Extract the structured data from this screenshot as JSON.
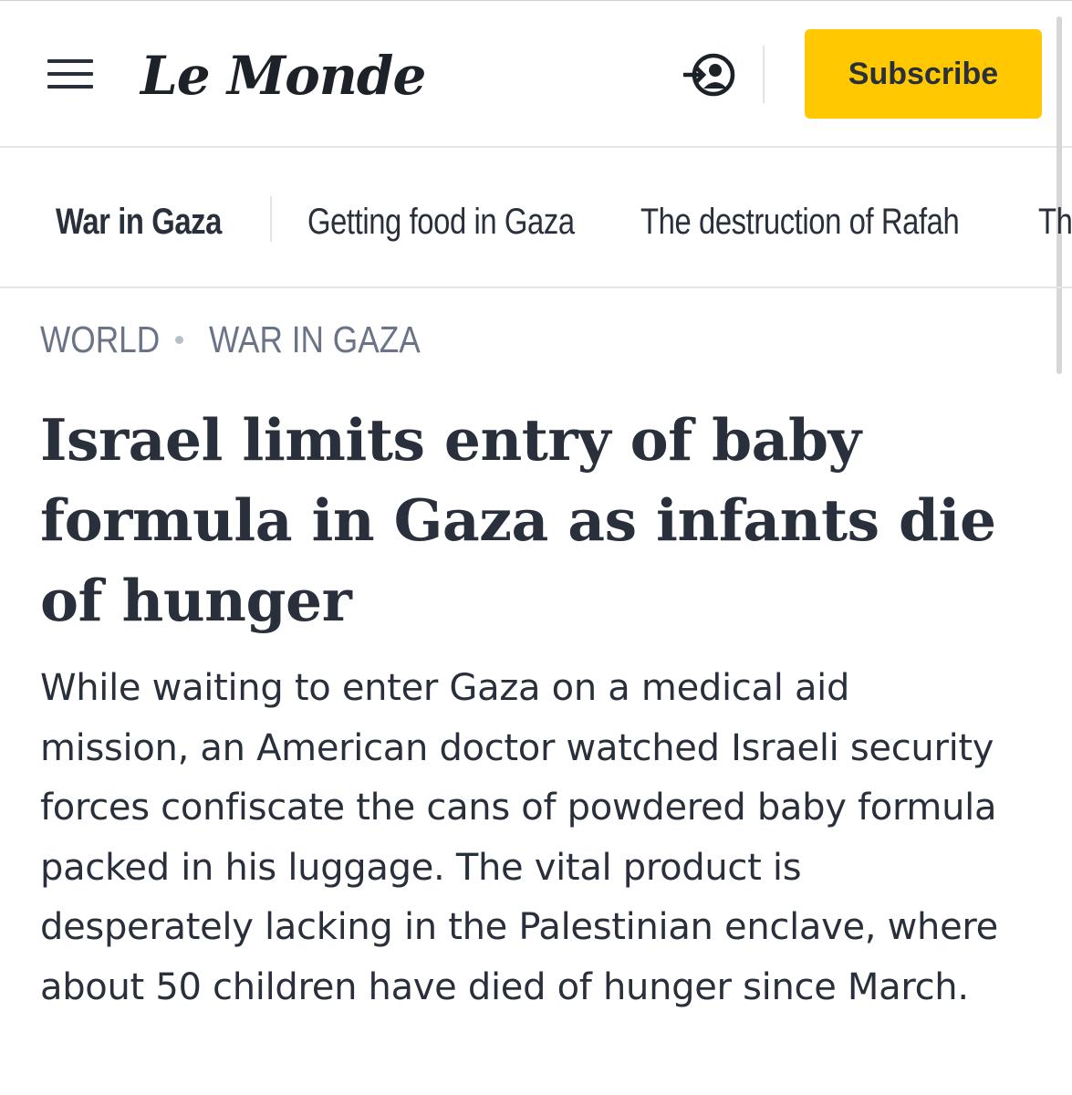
{
  "header": {
    "menu_icon": "hamburger-menu-icon",
    "logo_text": "Le Monde",
    "login_icon": "login-arrow-icon",
    "subscribe_label": "Subscribe",
    "subscribe_color": "#ffc800"
  },
  "tags": [
    {
      "label": "War in Gaza",
      "active": true
    },
    {
      "label": "Getting food in Gaza",
      "active": false
    },
    {
      "label": "The destruction of Rafah",
      "active": false
    },
    {
      "label": "Th",
      "active": false
    }
  ],
  "breadcrumb": {
    "section": "WORLD",
    "subsection": "WAR IN GAZA"
  },
  "article": {
    "headline": "Israel limits entry of baby formula in Gaza as infants die of hunger",
    "lede": "While waiting to enter Gaza on a medical aid mission, an American doctor watched Israeli security forces confiscate the cans of powdered baby formula packed in his luggage. The vital product is desperately lacking in the Palestinian enclave, where about 50 children have died of hunger since March."
  }
}
